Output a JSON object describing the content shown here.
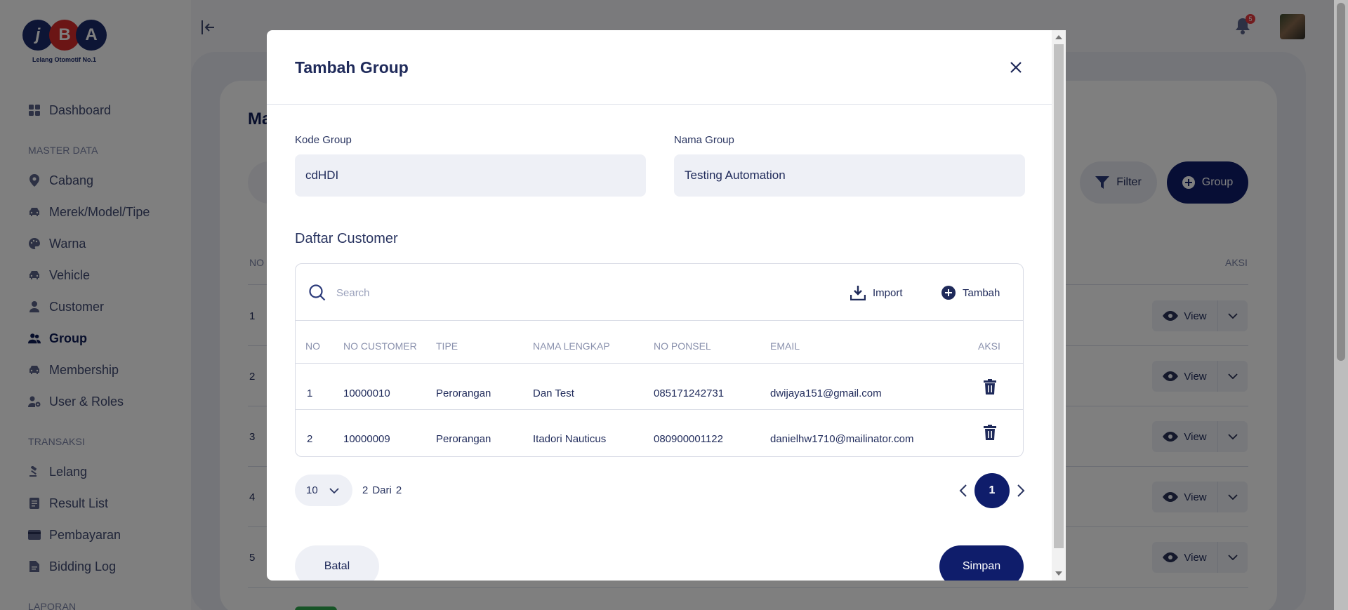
{
  "app": {
    "logo_letters": [
      "j",
      "B",
      "A"
    ],
    "logo_tagline": "Lelang Otomotif No.1",
    "notification_count": "5"
  },
  "sidebar": {
    "sections": [
      {
        "title": "",
        "items": [
          {
            "label": "Dashboard",
            "icon": "dashboard-icon"
          }
        ]
      },
      {
        "title": "MASTER DATA",
        "items": [
          {
            "label": "Cabang",
            "icon": "location-pin-icon"
          },
          {
            "label": "Merek/Model/Tipe",
            "icon": "car-icon"
          },
          {
            "label": "Warna",
            "icon": "palette-icon"
          },
          {
            "label": "Vehicle",
            "icon": "car-icon"
          },
          {
            "label": "Customer",
            "icon": "user-icon"
          },
          {
            "label": "Group",
            "icon": "users-icon",
            "active": true
          },
          {
            "label": "Membership",
            "icon": "car-icon"
          },
          {
            "label": "User & Roles",
            "icon": "user-gear-icon"
          }
        ]
      },
      {
        "title": "TRANSAKSI",
        "items": [
          {
            "label": "Lelang",
            "icon": "gavel-icon"
          },
          {
            "label": "Result List",
            "icon": "list-icon"
          },
          {
            "label": "Pembayaran",
            "icon": "card-icon"
          },
          {
            "label": "Bidding Log",
            "icon": "document-icon"
          }
        ]
      },
      {
        "title": "LAPORAN",
        "items": []
      }
    ]
  },
  "background_page": {
    "title": "Ma",
    "filter_label": "Filter",
    "add_group_label": "Group",
    "col_no": "NO",
    "col_aksi": "AKSI",
    "row_numbers": [
      "1",
      "2",
      "3",
      "4",
      "5"
    ],
    "view_label": "View"
  },
  "modal": {
    "title": "Tambah Group",
    "kode_group_label": "Kode Group",
    "kode_group_value": "cdHDI",
    "nama_group_label": "Nama Group",
    "nama_group_value": "Testing Automation",
    "customer_section_title": "Daftar Customer",
    "search_placeholder": "Search",
    "import_label": "Import",
    "tambah_label": "Tambah",
    "columns": [
      "NO",
      "NO CUSTOMER",
      "TIPE",
      "NAMA LENGKAP",
      "NO PONSEL",
      "EMAIL",
      "AKSI"
    ],
    "rows": [
      {
        "no": "1",
        "no_customer": "10000010",
        "tipe": "Perorangan",
        "nama": "Dan Test",
        "ponsel": "085171242731",
        "email": "dwijaya151@gmail.com"
      },
      {
        "no": "2",
        "no_customer": "10000009",
        "tipe": "Perorangan",
        "nama": "Itadori Nauticus",
        "ponsel": "080900001122",
        "email": "danielhw1710@mailinator.com"
      }
    ],
    "per_page": "10",
    "range_count": "2",
    "range_of": "Dari",
    "range_total": "2",
    "current_page": "1",
    "batal_label": "Batal",
    "simpan_label": "Simpan"
  },
  "colors": {
    "primary": "#0f1d6b",
    "danger_badge": "#e5393e",
    "text_dark": "#1f2a5a"
  }
}
